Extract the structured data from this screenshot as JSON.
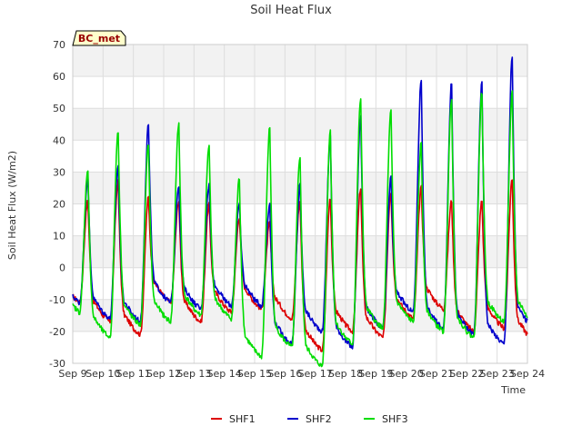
{
  "chart_data": {
    "type": "line",
    "title": "Soil Heat Flux",
    "xlabel": "Time",
    "ylabel": "Soil Heat Flux (W/m2)",
    "badge": "BC_met",
    "ylim": [
      -30,
      70
    ],
    "yticks": [
      -30,
      -20,
      -10,
      0,
      10,
      20,
      30,
      40,
      50,
      60,
      70
    ],
    "xlim": [
      9,
      24
    ],
    "xticks": [
      {
        "v": 9,
        "label": "Sep 9"
      },
      {
        "v": 10,
        "label": "Sep 10"
      },
      {
        "v": 11,
        "label": "Sep 11"
      },
      {
        "v": 12,
        "label": "Sep 12"
      },
      {
        "v": 13,
        "label": "Sep 13"
      },
      {
        "v": 14,
        "label": "Sep 14"
      },
      {
        "v": 15,
        "label": "Sep 15"
      },
      {
        "v": 16,
        "label": "Sep 16"
      },
      {
        "v": 17,
        "label": "Sep 17"
      },
      {
        "v": 18,
        "label": "Sep 18"
      },
      {
        "v": 19,
        "label": "Sep 19"
      },
      {
        "v": 20,
        "label": "Sep 20"
      },
      {
        "v": 21,
        "label": "Sep 21"
      },
      {
        "v": 22,
        "label": "Sep 22"
      },
      {
        "v": 23,
        "label": "Sep 23"
      },
      {
        "v": 24,
        "label": "Sep 24"
      }
    ],
    "grid": true,
    "legend_position": "bottom-center",
    "series": [
      {
        "name": "SHF1",
        "color": "#dd0000",
        "days": [
          {
            "start": -9,
            "max": 21,
            "min": -15
          },
          {
            "start": -15,
            "max": 27,
            "min": -19
          },
          {
            "start": -19,
            "max": 22,
            "min": -9
          },
          {
            "start": -9,
            "max": 21,
            "min": -15
          },
          {
            "start": -15,
            "max": 20,
            "min": -12
          },
          {
            "start": -12,
            "max": 16,
            "min": -11
          },
          {
            "start": -11,
            "max": 14,
            "min": -14
          },
          {
            "start": -14,
            "max": 21,
            "min": -24
          },
          {
            "start": -24,
            "max": 22,
            "min": -18
          },
          {
            "start": -18,
            "max": 25,
            "min": -20
          },
          {
            "start": -20,
            "max": 24,
            "min": -14
          },
          {
            "start": -14,
            "max": 25,
            "min": -11
          },
          {
            "start": -11,
            "max": 21,
            "min": -18
          },
          {
            "start": -18,
            "max": 21,
            "min": -17
          },
          {
            "start": -17,
            "max": 28,
            "min": -21
          }
        ]
      },
      {
        "name": "SHF2",
        "color": "#0000cc",
        "days": [
          {
            "start": -9,
            "max": 28,
            "min": -14
          },
          {
            "start": -14,
            "max": 32,
            "min": -15
          },
          {
            "start": -15,
            "max": 45,
            "min": -9
          },
          {
            "start": -9,
            "max": 26,
            "min": -11
          },
          {
            "start": -11,
            "max": 26,
            "min": -10
          },
          {
            "start": -10,
            "max": 20,
            "min": -10
          },
          {
            "start": -10,
            "max": 20,
            "min": -22
          },
          {
            "start": -22,
            "max": 26,
            "min": -18
          },
          {
            "start": -18,
            "max": 41,
            "min": -23
          },
          {
            "start": -23,
            "max": 47,
            "min": -17
          },
          {
            "start": -17,
            "max": 28,
            "min": -12
          },
          {
            "start": -12,
            "max": 59,
            "min": -17
          },
          {
            "start": -17,
            "max": 58,
            "min": -19
          },
          {
            "start": -19,
            "max": 58,
            "min": -22
          },
          {
            "start": -22,
            "max": 66,
            "min": -17
          }
        ]
      },
      {
        "name": "SHF3",
        "color": "#00dd00",
        "days": [
          {
            "start": -12,
            "max": 31,
            "min": -20
          },
          {
            "start": -20,
            "max": 43,
            "min": -16
          },
          {
            "start": -16,
            "max": 39,
            "min": -15
          },
          {
            "start": -15,
            "max": 45,
            "min": -13
          },
          {
            "start": -13,
            "max": 38,
            "min": -14
          },
          {
            "start": -14,
            "max": 28,
            "min": -26
          },
          {
            "start": -26,
            "max": 44,
            "min": -23
          },
          {
            "start": -23,
            "max": 35,
            "min": -29
          },
          {
            "start": -29,
            "max": 43,
            "min": -22
          },
          {
            "start": -22,
            "max": 53,
            "min": -17
          },
          {
            "start": -17,
            "max": 49,
            "min": -15
          },
          {
            "start": -15,
            "max": 39,
            "min": -18
          },
          {
            "start": -18,
            "max": 53,
            "min": -20
          },
          {
            "start": -20,
            "max": 55,
            "min": -15
          },
          {
            "start": -15,
            "max": 55,
            "min": -15
          }
        ]
      }
    ]
  }
}
